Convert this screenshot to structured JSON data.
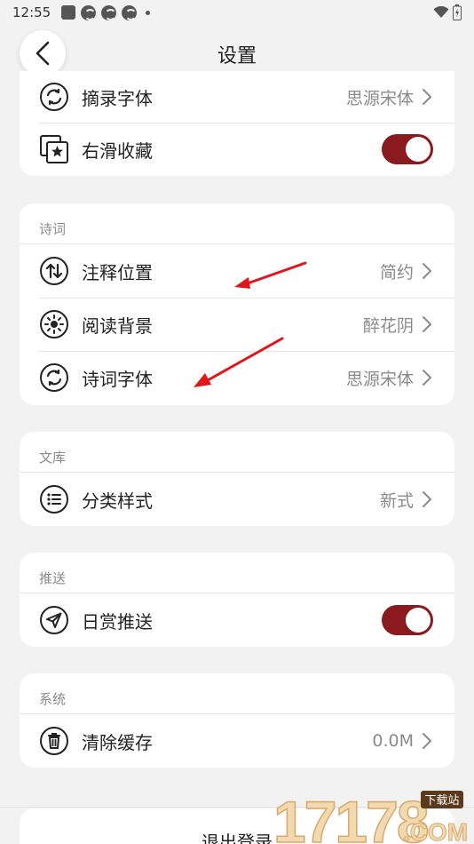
{
  "status_bar": {
    "time": "12:55"
  },
  "header": {
    "title": "设置"
  },
  "card_top": {
    "rows": [
      {
        "label": "摘录字体",
        "value": "思源宋体",
        "icon": "swap-icon"
      },
      {
        "label": "右滑收藏",
        "toggle": true,
        "icon": "star-collection-icon"
      }
    ]
  },
  "poetry": {
    "title": "诗词",
    "rows": [
      {
        "label": "注释位置",
        "value": "简约",
        "icon": "sort-arrows-icon"
      },
      {
        "label": "阅读背景",
        "value": "醉花阴",
        "icon": "sun-icon"
      },
      {
        "label": "诗词字体",
        "value": "思源宋体",
        "icon": "swap-icon"
      }
    ]
  },
  "library": {
    "title": "文库",
    "rows": [
      {
        "label": "分类样式",
        "value": "新式",
        "icon": "list-icon"
      }
    ]
  },
  "push": {
    "title": "推送",
    "rows": [
      {
        "label": "日赏推送",
        "toggle": true,
        "icon": "send-icon"
      }
    ]
  },
  "system": {
    "title": "系统",
    "rows": [
      {
        "label": "清除缓存",
        "value": "0.0M",
        "icon": "trash-icon"
      }
    ]
  },
  "logout": {
    "label": "退出登录"
  },
  "watermark": {
    "text": "17178",
    "badge": "下载站",
    "domain": ".COM"
  },
  "colors": {
    "accent": "#8b1a1f",
    "background": "#f2f2f2",
    "arrow": "#e0161b"
  }
}
